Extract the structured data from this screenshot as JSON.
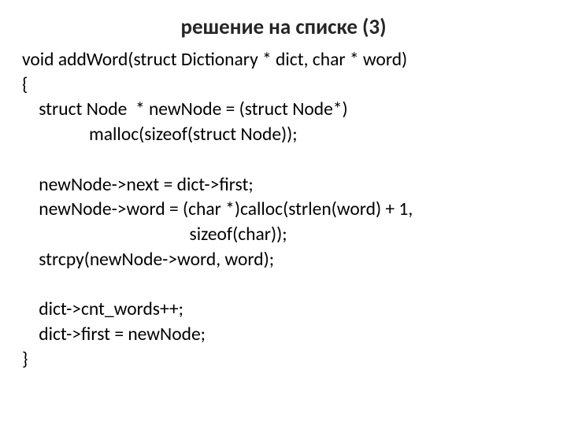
{
  "title": "решение на списке (3)",
  "code": {
    "l1": "void addWord(struct Dictionary * dict, char * word)",
    "l2": "{",
    "l3": "    struct Node  * newNode = (struct Node*)",
    "l4": "                malloc(sizeof(struct Node));",
    "l5": "",
    "l6": "    newNode->next = dict->first;",
    "l7": "    newNode->word = (char *)calloc(strlen(word) + 1,",
    "l8": "                                        sizeof(char));",
    "l9": "    strcpy(newNode->word, word);",
    "l10": "",
    "l11": "    dict->cnt_words++;",
    "l12": "    dict->first = newNode;",
    "l13": "}"
  }
}
